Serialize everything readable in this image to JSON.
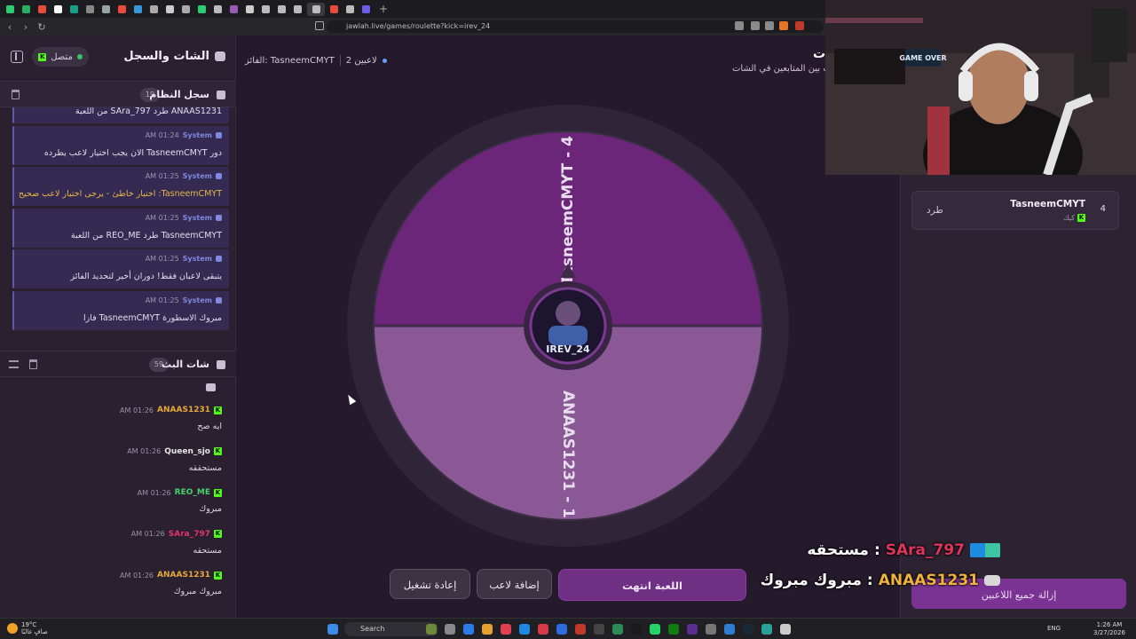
{
  "browser": {
    "url": "jawlah.live/games/roulette?kick=irev_24",
    "tab_colors": [
      "#2ecc71",
      "#27ae60",
      "#e74c3c",
      "#ffffff",
      "#16a085",
      "#888888",
      "#95a5a6",
      "#e74c3c",
      "#3498db",
      "#aaaaaa",
      "#cccccc",
      "#aaaaaa",
      "#2ecc71",
      "#bbbbbb",
      "#9b59b6",
      "#cccccc",
      "#bbbbbb",
      "#bbbbbb",
      "#bbbbbb",
      "#bbbbbb",
      "#e74c3c",
      "#bbbbbb",
      "#6c5ce7"
    ],
    "new_tab": "+"
  },
  "left_panel": {
    "title": "الشات والسجل",
    "status": "متصل",
    "system_log": {
      "title": "سجل النظام",
      "count": "19",
      "items": [
        {
          "sender": "System",
          "time": "AM 01:24",
          "text": "ANAAS1231 طرد SAra_797 من اللعبة",
          "warn": false
        },
        {
          "sender": "System",
          "time": "AM 01:24",
          "text": "دور TasneemCMYT الان يجب اختيار لاعب يطرده",
          "warn": false
        },
        {
          "sender": "System",
          "time": "AM 01:25",
          "text": "TasneemCMYT: اختيار خاطئ - يرجى اختيار لاعب صحيح",
          "warn": true
        },
        {
          "sender": "System",
          "time": "AM 01:25",
          "text": "TasneemCMYT طرد REO_ME من اللعبة",
          "warn": false
        },
        {
          "sender": "System",
          "time": "AM 01:25",
          "text": "يتبقى لاعبان فقط! دوران أخير لتحديد الفائز",
          "warn": false
        },
        {
          "sender": "System",
          "time": "AM 01:25",
          "text": "مبروك الاسطورة TasneemCMYT فازا",
          "warn": false
        }
      ]
    },
    "stream_chat": {
      "title": "شات البث",
      "count": "59",
      "messages": [
        {
          "user": "ANAAS1231",
          "time": "AM 01:26",
          "text": "ايه صح",
          "color": "#e5a93a"
        },
        {
          "user": "Queen_sjo",
          "time": "AM 01:26",
          "text": "مستحققه",
          "color": "#e6e6e6"
        },
        {
          "user": "REO_ME",
          "time": "AM 01:26",
          "text": "مبروك",
          "color": "#46d36b"
        },
        {
          "user": "SAra_797",
          "time": "AM 01:26",
          "text": "مستحقه",
          "color": "#e0356b"
        },
        {
          "user": "ANAAS1231",
          "time": "AM 01:26",
          "text": "مبروك مبروك",
          "color": "#e5a93a"
        }
      ]
    }
  },
  "main": {
    "players_count": "2 لاعبين",
    "winner": "الفائز: TasneemCMYT",
    "title_fragment": "ت",
    "subtitle": "ب بين المتابعين في الشات",
    "wheel": {
      "segments": [
        {
          "label": "TasneemCMYT - 4",
          "color": "#6c2679"
        },
        {
          "label": "ANAAS1231 - 1",
          "color": "#8b5896"
        }
      ],
      "center_label": "IREV_24"
    },
    "buttons": {
      "end": "اللعبة انتهت",
      "add_player": "إضافة لاعب",
      "restart": "إعادة تشغيل"
    }
  },
  "right_panel": {
    "player": {
      "number": "4",
      "name": "TasneemCMYT",
      "platform": "كيك",
      "kick_label": "طرد"
    },
    "remove_all": "إزالة جميع اللاعبين"
  },
  "overlay": {
    "messages": [
      {
        "user": "SAra_797",
        "text": "مستحقه",
        "color": "#e0355b"
      },
      {
        "user": "ANAAS1231",
        "text": "مبروك مبروك",
        "color": "#f0b23a"
      }
    ]
  },
  "webcam": {
    "sign": "GAME OVER"
  },
  "taskbar": {
    "weather_temp": "19°C",
    "weather_desc": "صافٍ غالبًا",
    "search": "Search",
    "lang": "ENG",
    "time": "1:26 AM",
    "date": "3/27/2026"
  }
}
